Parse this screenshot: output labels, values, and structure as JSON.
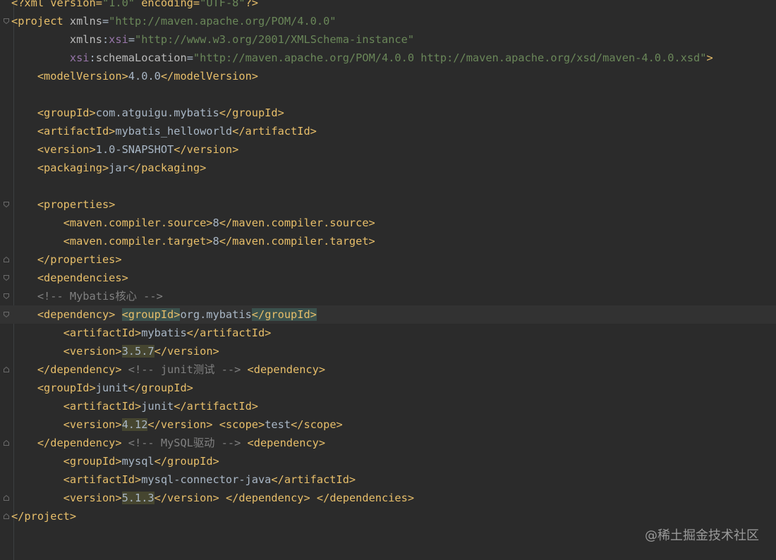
{
  "editor": {
    "file_lines": [
      {
        "id": "l1",
        "parts": [
          {
            "c": "pi",
            "t": "<?xml version="
          },
          {
            "c": "val",
            "t": "\"1.0\""
          },
          {
            "c": "pi",
            "t": " encoding="
          },
          {
            "c": "val",
            "t": "\"UTF-8\""
          },
          {
            "c": "pi",
            "t": "?>"
          }
        ]
      },
      {
        "id": "l2",
        "fold": "open",
        "parts": [
          {
            "c": "tag",
            "t": "<project "
          },
          {
            "c": "attr",
            "t": "xmlns"
          },
          {
            "c": "txt",
            "t": "="
          },
          {
            "c": "val",
            "t": "\"http://maven.apache.org/POM/4.0.0\""
          }
        ]
      },
      {
        "id": "l3",
        "parts": [
          {
            "c": "txt",
            "t": "         "
          },
          {
            "c": "attr",
            "t": "xmlns"
          },
          {
            "c": "txt",
            "t": ":"
          },
          {
            "c": "ns",
            "t": "xsi"
          },
          {
            "c": "txt",
            "t": "="
          },
          {
            "c": "val",
            "t": "\"http://www.w3.org/2001/XMLSchema-instance\""
          }
        ]
      },
      {
        "id": "l4",
        "parts": [
          {
            "c": "txt",
            "t": "         "
          },
          {
            "c": "ns",
            "t": "xsi"
          },
          {
            "c": "txt",
            "t": ":"
          },
          {
            "c": "attr",
            "t": "schemaLocation"
          },
          {
            "c": "txt",
            "t": "="
          },
          {
            "c": "val",
            "t": "\"http://maven.apache.org/POM/4.0.0 http://maven.apache.org/xsd/maven-4.0.0.xsd\""
          },
          {
            "c": "tag",
            "t": ">"
          }
        ]
      },
      {
        "id": "l5",
        "parts": [
          {
            "c": "txt",
            "t": "    "
          },
          {
            "c": "tag",
            "t": "<modelVersion>"
          },
          {
            "c": "txt",
            "t": "4.0.0"
          },
          {
            "c": "tag",
            "t": "</modelVersion>"
          }
        ]
      },
      {
        "id": "l6",
        "parts": []
      },
      {
        "id": "l7",
        "parts": [
          {
            "c": "txt",
            "t": "    "
          },
          {
            "c": "tag",
            "t": "<groupId>"
          },
          {
            "c": "txt",
            "t": "com.atguigu.mybatis"
          },
          {
            "c": "tag",
            "t": "</groupId>"
          }
        ]
      },
      {
        "id": "l8",
        "parts": [
          {
            "c": "txt",
            "t": "    "
          },
          {
            "c": "tag",
            "t": "<artifactId>"
          },
          {
            "c": "txt",
            "t": "mybatis_helloworld"
          },
          {
            "c": "tag",
            "t": "</artifactId>"
          }
        ]
      },
      {
        "id": "l9",
        "parts": [
          {
            "c": "txt",
            "t": "    "
          },
          {
            "c": "tag",
            "t": "<version>"
          },
          {
            "c": "txt",
            "t": "1.0-SNAPSHOT"
          },
          {
            "c": "tag",
            "t": "</version>"
          }
        ]
      },
      {
        "id": "l10",
        "parts": [
          {
            "c": "txt",
            "t": "    "
          },
          {
            "c": "tag",
            "t": "<packaging>"
          },
          {
            "c": "txt",
            "t": "jar"
          },
          {
            "c": "tag",
            "t": "</packaging>"
          }
        ]
      },
      {
        "id": "l11",
        "parts": []
      },
      {
        "id": "l12",
        "fold": "open",
        "parts": [
          {
            "c": "txt",
            "t": "    "
          },
          {
            "c": "tag",
            "t": "<properties>"
          }
        ]
      },
      {
        "id": "l13",
        "parts": [
          {
            "c": "txt",
            "t": "        "
          },
          {
            "c": "tag",
            "t": "<maven.compiler.source>"
          },
          {
            "c": "txt",
            "t": "8"
          },
          {
            "c": "tag",
            "t": "</maven.compiler.source>"
          }
        ]
      },
      {
        "id": "l14",
        "parts": [
          {
            "c": "txt",
            "t": "        "
          },
          {
            "c": "tag",
            "t": "<maven.compiler.target>"
          },
          {
            "c": "txt",
            "t": "8"
          },
          {
            "c": "tag",
            "t": "</maven.compiler.target>"
          }
        ]
      },
      {
        "id": "l15",
        "fold": "close",
        "parts": [
          {
            "c": "txt",
            "t": "    "
          },
          {
            "c": "tag",
            "t": "</properties>"
          }
        ]
      },
      {
        "id": "l16",
        "fold": "open",
        "parts": [
          {
            "c": "txt",
            "t": "    "
          },
          {
            "c": "tag",
            "t": "<dependencies>"
          }
        ]
      },
      {
        "id": "l17",
        "fold": "open",
        "parts": [
          {
            "c": "txt",
            "t": "    "
          },
          {
            "c": "com",
            "t": "<!-- Mybatis核心 -->"
          }
        ]
      },
      {
        "id": "l18",
        "fold": "open",
        "current": true,
        "parts": [
          {
            "c": "txt",
            "t": "    "
          },
          {
            "c": "tag",
            "t": "<dependency> "
          },
          {
            "c": "tag hl-tag",
            "t": "<groupId>"
          },
          {
            "c": "txt",
            "t": "org.mybatis"
          },
          {
            "c": "tag hl-tag",
            "t": "</groupId>"
          }
        ]
      },
      {
        "id": "l19",
        "parts": [
          {
            "c": "txt",
            "t": "        "
          },
          {
            "c": "tag",
            "t": "<artifactId>"
          },
          {
            "c": "txt",
            "t": "mybatis"
          },
          {
            "c": "tag",
            "t": "</artifactId>"
          }
        ]
      },
      {
        "id": "l20",
        "parts": [
          {
            "c": "txt",
            "t": "        "
          },
          {
            "c": "tag",
            "t": "<version>"
          },
          {
            "c": "txt hl-num",
            "t": "3.5.7"
          },
          {
            "c": "tag",
            "t": "</version>"
          }
        ]
      },
      {
        "id": "l21",
        "fold": "close",
        "parts": [
          {
            "c": "txt",
            "t": "    "
          },
          {
            "c": "tag",
            "t": "</dependency> "
          },
          {
            "c": "com",
            "t": "<!-- junit测试 -->"
          },
          {
            "c": "txt",
            "t": " "
          },
          {
            "c": "tag",
            "t": "<dependency>"
          }
        ]
      },
      {
        "id": "l22",
        "parts": [
          {
            "c": "txt",
            "t": "    "
          },
          {
            "c": "tag",
            "t": "<groupId>"
          },
          {
            "c": "txt",
            "t": "junit"
          },
          {
            "c": "tag",
            "t": "</groupId>"
          }
        ]
      },
      {
        "id": "l23",
        "parts": [
          {
            "c": "txt",
            "t": "        "
          },
          {
            "c": "tag",
            "t": "<artifactId>"
          },
          {
            "c": "txt",
            "t": "junit"
          },
          {
            "c": "tag",
            "t": "</artifactId>"
          }
        ]
      },
      {
        "id": "l24",
        "parts": [
          {
            "c": "txt",
            "t": "        "
          },
          {
            "c": "tag",
            "t": "<version>"
          },
          {
            "c": "txt hl-num",
            "t": "4.12"
          },
          {
            "c": "tag",
            "t": "</version>"
          },
          {
            "c": "txt",
            "t": " "
          },
          {
            "c": "tag",
            "t": "<scope>"
          },
          {
            "c": "txt",
            "t": "test"
          },
          {
            "c": "tag",
            "t": "</scope>"
          }
        ]
      },
      {
        "id": "l25",
        "fold": "close",
        "parts": [
          {
            "c": "txt",
            "t": "    "
          },
          {
            "c": "tag",
            "t": "</dependency> "
          },
          {
            "c": "com",
            "t": "<!-- MySQL驱动 -->"
          },
          {
            "c": "txt",
            "t": " "
          },
          {
            "c": "tag",
            "t": "<dependency>"
          }
        ]
      },
      {
        "id": "l26",
        "parts": [
          {
            "c": "txt",
            "t": "        "
          },
          {
            "c": "tag",
            "t": "<groupId>"
          },
          {
            "c": "txt",
            "t": "mysql"
          },
          {
            "c": "tag",
            "t": "</groupId>"
          }
        ]
      },
      {
        "id": "l27",
        "parts": [
          {
            "c": "txt",
            "t": "        "
          },
          {
            "c": "tag",
            "t": "<artifactId>"
          },
          {
            "c": "txt",
            "t": "mysql-connector-java"
          },
          {
            "c": "tag",
            "t": "</artifactId>"
          }
        ]
      },
      {
        "id": "l28",
        "fold": "close",
        "parts": [
          {
            "c": "txt",
            "t": "        "
          },
          {
            "c": "tag",
            "t": "<version>"
          },
          {
            "c": "txt hl-num",
            "t": "5.1.3"
          },
          {
            "c": "tag",
            "t": "</version>"
          },
          {
            "c": "txt",
            "t": " "
          },
          {
            "c": "tag",
            "t": "</dependency>"
          },
          {
            "c": "txt",
            "t": " "
          },
          {
            "c": "tag",
            "t": "</dependencies>"
          }
        ]
      },
      {
        "id": "l29",
        "fold": "close",
        "parts": [
          {
            "c": "tag",
            "t": "</project>"
          }
        ]
      }
    ]
  },
  "watermark": {
    "text": "@稀土掘金技术社区"
  },
  "colors": {
    "background": "#2b2b2b",
    "tag": "#e8bf6a",
    "string": "#6a8759",
    "comment": "#808080",
    "text": "#a9b7c6",
    "namespace": "#9876aa"
  },
  "icons": {
    "fold_open": "fold-open-icon",
    "fold_close": "fold-close-icon"
  }
}
